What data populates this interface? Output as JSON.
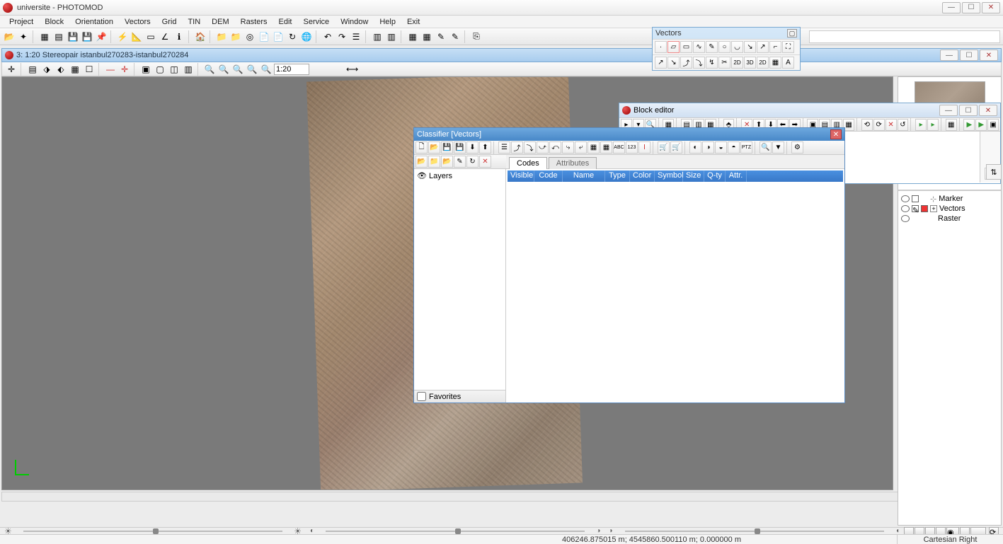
{
  "app": {
    "title": "universite - PHOTOMOD"
  },
  "menu": [
    "Project",
    "Block",
    "Orientation",
    "Vectors",
    "Grid",
    "TIN",
    "DEM",
    "Rasters",
    "Edit",
    "Service",
    "Window",
    "Help",
    "Exit"
  ],
  "vectors_panel": {
    "title": "Vectors"
  },
  "stereo": {
    "title": "3: 1:20 Stereopair istanbul270283-istanbul270284",
    "zoom": "1:20"
  },
  "block_editor": {
    "title": "Block editor"
  },
  "classifier": {
    "title": "Classifier [Vectors]",
    "tree_root": "Layers",
    "favorites": "Favorites",
    "tabs": [
      "Codes",
      "Attributes"
    ],
    "columns": [
      "Visible",
      "Code",
      "Name",
      "Type",
      "Color",
      "Symbol",
      "Size",
      "Q-ty",
      "Attr."
    ]
  },
  "layers": {
    "items": [
      {
        "name": "Marker"
      },
      {
        "name": "Vectors"
      },
      {
        "name": "Raster"
      }
    ]
  },
  "status": {
    "coords": "406246.875015 m; 4545860.500110 m; 0.000000 m",
    "system": "Cartesian Right"
  }
}
